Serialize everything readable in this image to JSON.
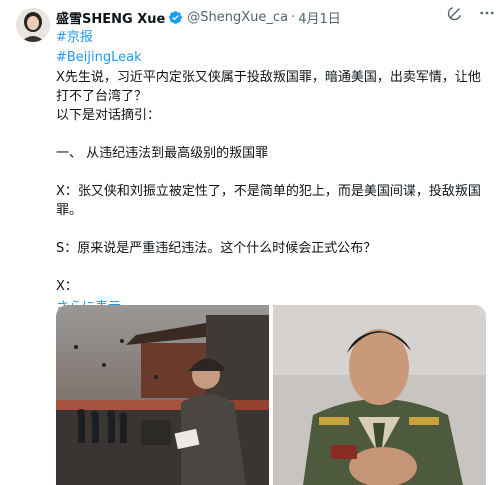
{
  "post": {
    "author_name": "盛雪SHENG Xue",
    "handle": "@ShengXue_ca",
    "separator": "·",
    "date": "4月1日",
    "hashtags": [
      "#京报",
      "#BeijingLeak"
    ],
    "paragraphs": [
      "X先生说，习近平内定张又侠属于投敌叛国罪，暗通美国，出卖军情，让他打不了台湾了？",
      "以下是对话摘引：",
      "",
      "一、 从违纪违法到最高级别的叛国罪",
      "",
      "X：张又侠和刘振立被定性了，不是简单的犯上，而是美国间谍，投敌叛国罪。",
      "",
      "S：原来说是严重违纪违法。这个什么时候会正式公布？",
      "",
      "X："
    ],
    "show_more": "さらに表示"
  },
  "colors": {
    "link": "#1d9bf0",
    "verified": "#1d9bf0",
    "text": "#0f1419",
    "muted": "#536471"
  },
  "icons": {
    "verified": "verified-badge-icon",
    "grok": "grok-icon",
    "more": "more-icon"
  }
}
